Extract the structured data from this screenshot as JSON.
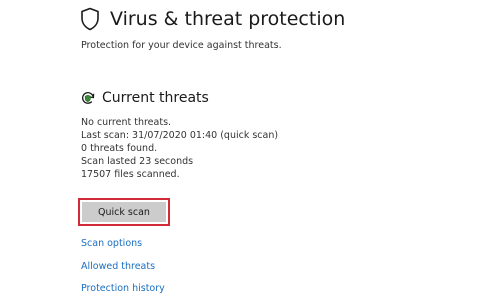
{
  "header": {
    "title": "Virus & threat protection",
    "icon": "shield-icon",
    "subtitle": "Protection for your device against threats."
  },
  "current_threats": {
    "title": "Current threats",
    "icon": "refresh-shield-icon",
    "status_lines": [
      "No current threats.",
      "Last scan: 31/07/2020 01:40 (quick scan)",
      "0 threats found.",
      "Scan lasted 23 seconds",
      "17507 files scanned."
    ],
    "quick_scan_label": "Quick scan",
    "highlight_color": "#d12b3a"
  },
  "links": {
    "scan_options": "Scan options",
    "allowed_threats": "Allowed threats",
    "protection_history": "Protection history",
    "link_color": "#1a6fc2"
  }
}
